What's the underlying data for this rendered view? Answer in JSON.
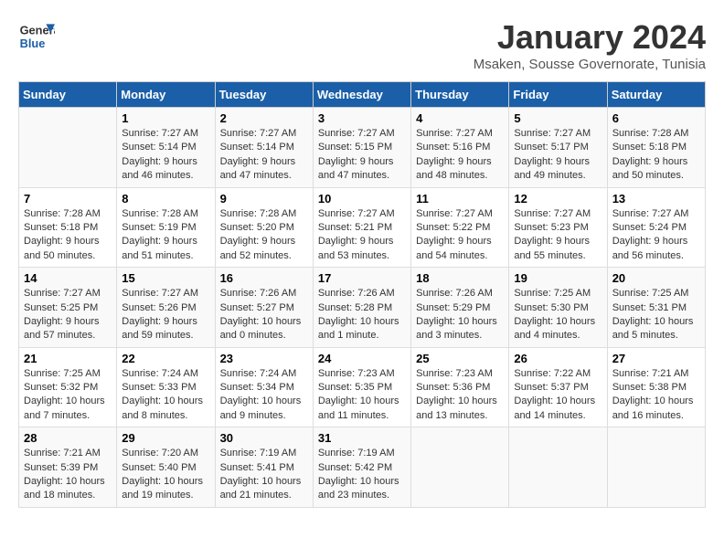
{
  "logo": {
    "line1": "General",
    "line2": "Blue"
  },
  "title": "January 2024",
  "subtitle": "Msaken, Sousse Governorate, Tunisia",
  "header_days": [
    "Sunday",
    "Monday",
    "Tuesday",
    "Wednesday",
    "Thursday",
    "Friday",
    "Saturday"
  ],
  "weeks": [
    [
      {
        "day": "",
        "content": ""
      },
      {
        "day": "1",
        "content": "Sunrise: 7:27 AM\nSunset: 5:14 PM\nDaylight: 9 hours\nand 46 minutes."
      },
      {
        "day": "2",
        "content": "Sunrise: 7:27 AM\nSunset: 5:14 PM\nDaylight: 9 hours\nand 47 minutes."
      },
      {
        "day": "3",
        "content": "Sunrise: 7:27 AM\nSunset: 5:15 PM\nDaylight: 9 hours\nand 47 minutes."
      },
      {
        "day": "4",
        "content": "Sunrise: 7:27 AM\nSunset: 5:16 PM\nDaylight: 9 hours\nand 48 minutes."
      },
      {
        "day": "5",
        "content": "Sunrise: 7:27 AM\nSunset: 5:17 PM\nDaylight: 9 hours\nand 49 minutes."
      },
      {
        "day": "6",
        "content": "Sunrise: 7:28 AM\nSunset: 5:18 PM\nDaylight: 9 hours\nand 50 minutes."
      }
    ],
    [
      {
        "day": "7",
        "content": "Sunrise: 7:28 AM\nSunset: 5:18 PM\nDaylight: 9 hours\nand 50 minutes."
      },
      {
        "day": "8",
        "content": "Sunrise: 7:28 AM\nSunset: 5:19 PM\nDaylight: 9 hours\nand 51 minutes."
      },
      {
        "day": "9",
        "content": "Sunrise: 7:28 AM\nSunset: 5:20 PM\nDaylight: 9 hours\nand 52 minutes."
      },
      {
        "day": "10",
        "content": "Sunrise: 7:27 AM\nSunset: 5:21 PM\nDaylight: 9 hours\nand 53 minutes."
      },
      {
        "day": "11",
        "content": "Sunrise: 7:27 AM\nSunset: 5:22 PM\nDaylight: 9 hours\nand 54 minutes."
      },
      {
        "day": "12",
        "content": "Sunrise: 7:27 AM\nSunset: 5:23 PM\nDaylight: 9 hours\nand 55 minutes."
      },
      {
        "day": "13",
        "content": "Sunrise: 7:27 AM\nSunset: 5:24 PM\nDaylight: 9 hours\nand 56 minutes."
      }
    ],
    [
      {
        "day": "14",
        "content": "Sunrise: 7:27 AM\nSunset: 5:25 PM\nDaylight: 9 hours\nand 57 minutes."
      },
      {
        "day": "15",
        "content": "Sunrise: 7:27 AM\nSunset: 5:26 PM\nDaylight: 9 hours\nand 59 minutes."
      },
      {
        "day": "16",
        "content": "Sunrise: 7:26 AM\nSunset: 5:27 PM\nDaylight: 10 hours\nand 0 minutes."
      },
      {
        "day": "17",
        "content": "Sunrise: 7:26 AM\nSunset: 5:28 PM\nDaylight: 10 hours\nand 1 minute."
      },
      {
        "day": "18",
        "content": "Sunrise: 7:26 AM\nSunset: 5:29 PM\nDaylight: 10 hours\nand 3 minutes."
      },
      {
        "day": "19",
        "content": "Sunrise: 7:25 AM\nSunset: 5:30 PM\nDaylight: 10 hours\nand 4 minutes."
      },
      {
        "day": "20",
        "content": "Sunrise: 7:25 AM\nSunset: 5:31 PM\nDaylight: 10 hours\nand 5 minutes."
      }
    ],
    [
      {
        "day": "21",
        "content": "Sunrise: 7:25 AM\nSunset: 5:32 PM\nDaylight: 10 hours\nand 7 minutes."
      },
      {
        "day": "22",
        "content": "Sunrise: 7:24 AM\nSunset: 5:33 PM\nDaylight: 10 hours\nand 8 minutes."
      },
      {
        "day": "23",
        "content": "Sunrise: 7:24 AM\nSunset: 5:34 PM\nDaylight: 10 hours\nand 9 minutes."
      },
      {
        "day": "24",
        "content": "Sunrise: 7:23 AM\nSunset: 5:35 PM\nDaylight: 10 hours\nand 11 minutes."
      },
      {
        "day": "25",
        "content": "Sunrise: 7:23 AM\nSunset: 5:36 PM\nDaylight: 10 hours\nand 13 minutes."
      },
      {
        "day": "26",
        "content": "Sunrise: 7:22 AM\nSunset: 5:37 PM\nDaylight: 10 hours\nand 14 minutes."
      },
      {
        "day": "27",
        "content": "Sunrise: 7:21 AM\nSunset: 5:38 PM\nDaylight: 10 hours\nand 16 minutes."
      }
    ],
    [
      {
        "day": "28",
        "content": "Sunrise: 7:21 AM\nSunset: 5:39 PM\nDaylight: 10 hours\nand 18 minutes."
      },
      {
        "day": "29",
        "content": "Sunrise: 7:20 AM\nSunset: 5:40 PM\nDaylight: 10 hours\nand 19 minutes."
      },
      {
        "day": "30",
        "content": "Sunrise: 7:19 AM\nSunset: 5:41 PM\nDaylight: 10 hours\nand 21 minutes."
      },
      {
        "day": "31",
        "content": "Sunrise: 7:19 AM\nSunset: 5:42 PM\nDaylight: 10 hours\nand 23 minutes."
      },
      {
        "day": "",
        "content": ""
      },
      {
        "day": "",
        "content": ""
      },
      {
        "day": "",
        "content": ""
      }
    ]
  ]
}
